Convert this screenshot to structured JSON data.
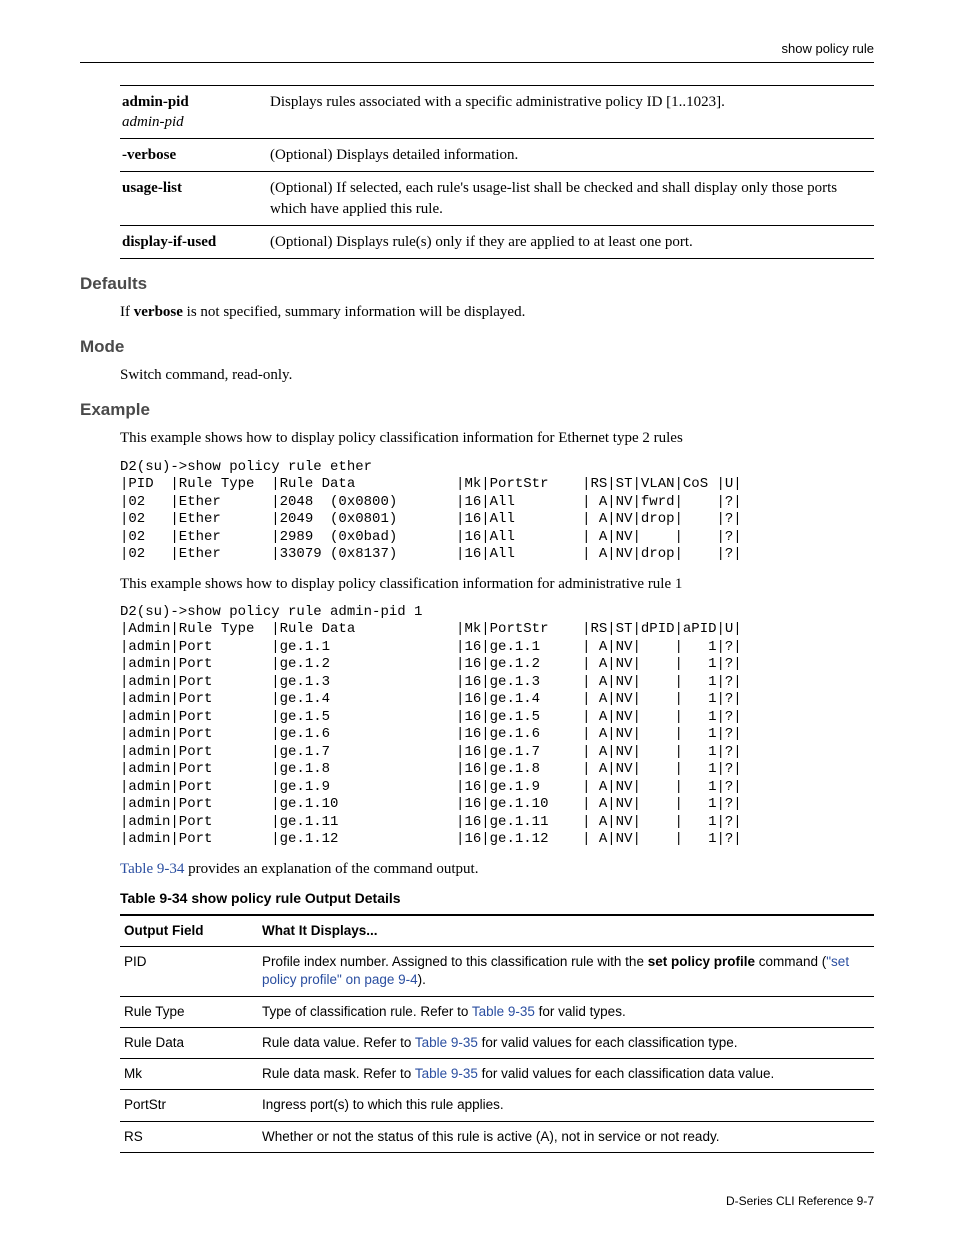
{
  "header": {
    "right": "show policy rule"
  },
  "param_table": [
    {
      "key_bold": "admin-pid",
      "key_italic": "admin-pid",
      "desc": "Displays rules associated with a specific administrative policy ID [1..1023]."
    },
    {
      "key_bold": "-verbose",
      "key_italic": "",
      "desc": "(Optional) Displays detailed information."
    },
    {
      "key_bold": "usage-list",
      "key_italic": "",
      "desc": "(Optional) If selected, each rule's usage-list shall be checked and shall display only those ports which have applied this rule."
    },
    {
      "key_bold": "display-if-used",
      "key_italic": "",
      "desc": "(Optional) Displays rule(s) only if they are applied to at least one port."
    }
  ],
  "sections": {
    "defaults_title": "Defaults",
    "defaults_pre": "If ",
    "defaults_bold": "verbose",
    "defaults_post": " is not specified, summary information will be displayed.",
    "mode_title": "Mode",
    "mode_text": "Switch command, read-only.",
    "example_title": "Example",
    "example_intro1": "This example shows how to display policy classification information for Ethernet type 2 rules",
    "code1": "D2(su)->show policy rule ether\n|PID  |Rule Type  |Rule Data            |Mk|PortStr    |RS|ST|VLAN|CoS |U|\n|02   |Ether      |2048  (0x0800)       |16|All        | A|NV|fwrd|    |?|\n|02   |Ether      |2049  (0x0801)       |16|All        | A|NV|drop|    |?|\n|02   |Ether      |2989  (0x0bad)       |16|All        | A|NV|    |    |?|\n|02   |Ether      |33079 (0x8137)       |16|All        | A|NV|drop|    |?|",
    "example_intro2": "This example shows how to display policy classification information for administrative rule 1",
    "code2": "D2(su)->show policy rule admin-pid 1\n|Admin|Rule Type  |Rule Data            |Mk|PortStr    |RS|ST|dPID|aPID|U|\n|admin|Port       |ge.1.1               |16|ge.1.1     | A|NV|    |   1|?|\n|admin|Port       |ge.1.2               |16|ge.1.2     | A|NV|    |   1|?|\n|admin|Port       |ge.1.3               |16|ge.1.3     | A|NV|    |   1|?|\n|admin|Port       |ge.1.4               |16|ge.1.4     | A|NV|    |   1|?|\n|admin|Port       |ge.1.5               |16|ge.1.5     | A|NV|    |   1|?|\n|admin|Port       |ge.1.6               |16|ge.1.6     | A|NV|    |   1|?|\n|admin|Port       |ge.1.7               |16|ge.1.7     | A|NV|    |   1|?|\n|admin|Port       |ge.1.8               |16|ge.1.8     | A|NV|    |   1|?|\n|admin|Port       |ge.1.9               |16|ge.1.9     | A|NV|    |   1|?|\n|admin|Port       |ge.1.10              |16|ge.1.10    | A|NV|    |   1|?|\n|admin|Port       |ge.1.11              |16|ge.1.11    | A|NV|    |   1|?|\n|admin|Port       |ge.1.12              |16|ge.1.12    | A|NV|    |   1|?|",
    "example_outro_xref": "Table 9-34",
    "example_outro_rest": " provides an explanation of the command output."
  },
  "output_table": {
    "caption": "Table 9-34   show policy rule Output Details",
    "head_field": "Output Field",
    "head_desc": "What It Displays...",
    "rows": [
      {
        "field": "PID",
        "desc_pre": "Profile index number. Assigned to this classification rule with the ",
        "bold": "set policy profile",
        "desc_mid": " command (",
        "xref": "\"set policy profile\" on page 9-4",
        "desc_post": ")."
      },
      {
        "field": "Rule Type",
        "desc_pre": "Type of classification rule. Refer to ",
        "xref": "Table 9-35",
        "desc_post": " for valid types."
      },
      {
        "field": "Rule Data",
        "desc_pre": "Rule data value. Refer to ",
        "xref": "Table 9-35",
        "desc_post": " for valid values for each classification type."
      },
      {
        "field": "Mk",
        "desc_pre": "Rule data mask. Refer to ",
        "xref": "Table 9-35",
        "desc_post": " for valid values for each classification data value."
      },
      {
        "field": "PortStr",
        "desc_pre": "Ingress port(s) to which this rule applies.",
        "xref": "",
        "desc_post": ""
      },
      {
        "field": "RS",
        "desc_pre": "Whether or not the status of this rule is active (A), not in service or not ready.",
        "xref": "",
        "desc_post": ""
      }
    ]
  },
  "footer": {
    "text": "D-Series CLI Reference   9-7"
  }
}
